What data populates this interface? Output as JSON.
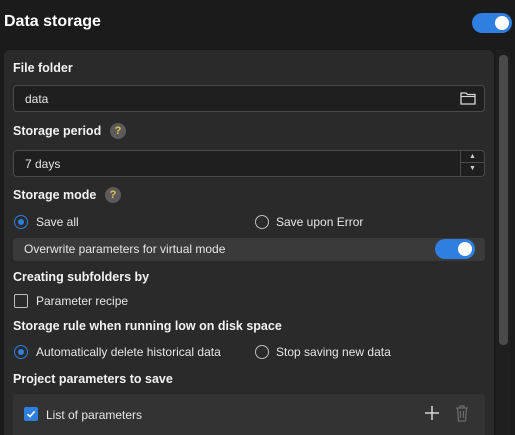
{
  "header": {
    "title": "Data storage",
    "enabled": true
  },
  "file_folder": {
    "label": "File folder",
    "value": "data"
  },
  "storage_period": {
    "label": "Storage period",
    "value": "7 days"
  },
  "storage_mode": {
    "label": "Storage mode",
    "options": [
      {
        "label": "Save all",
        "selected": true
      },
      {
        "label": "Save upon Error",
        "selected": false
      }
    ],
    "overwrite_label": "Overwrite parameters for virtual mode",
    "overwrite_enabled": true
  },
  "subfolders": {
    "label": "Creating subfolders by",
    "option_label": "Parameter recipe",
    "checked": false
  },
  "disk_rule": {
    "label": "Storage rule when running low on disk space",
    "options": [
      {
        "label": "Automatically delete historical data",
        "selected": true
      },
      {
        "label": "Stop saving new data",
        "selected": false
      }
    ]
  },
  "project_params": {
    "label": "Project parameters to save",
    "item_label": "List of parameters",
    "checked": true
  },
  "colors": {
    "accent": "#2f7fe0",
    "background": "#1b1b1b",
    "panel": "#2a2a2a"
  },
  "help_glyph": "?"
}
